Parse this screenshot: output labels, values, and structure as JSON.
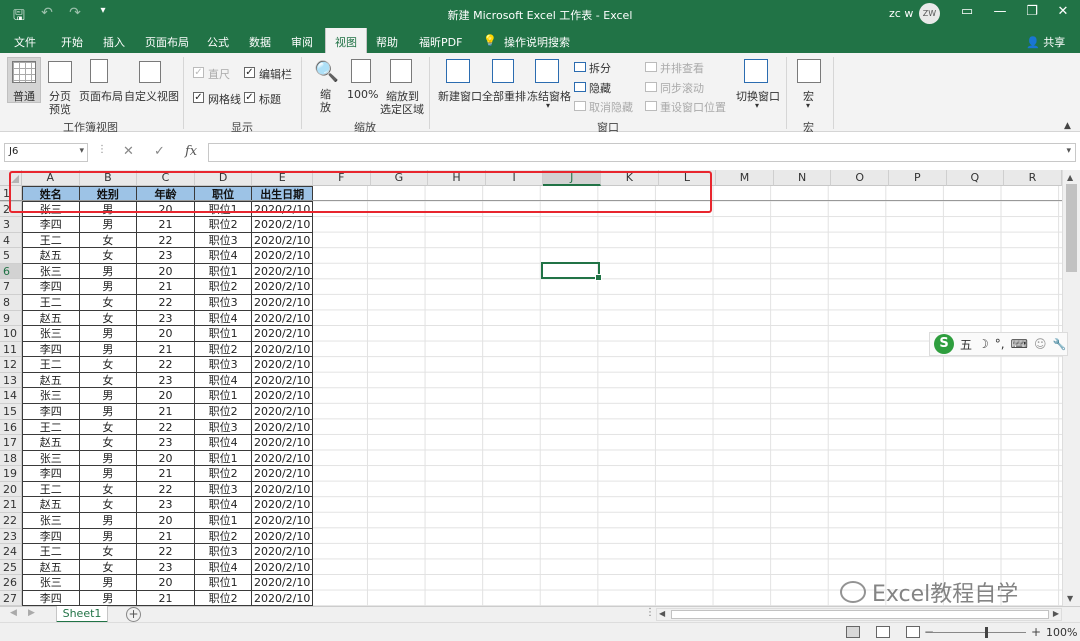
{
  "titlebar": {
    "title": "新建 Microsoft Excel 工作表 - Excel",
    "user": "zc w",
    "avatar": "ZW"
  },
  "menu": {
    "tabs": [
      "文件",
      "开始",
      "插入",
      "页面布局",
      "公式",
      "数据",
      "审阅",
      "视图",
      "帮助",
      "福昕PDF"
    ],
    "active": "视图",
    "tell_me": "操作说明搜索",
    "share": "共享"
  },
  "ribbon": {
    "workbook_views": {
      "normal": "普通",
      "page_break_1": "分页",
      "page_break_2": "预览",
      "page_layout": "页面布局",
      "custom": "自定义视图",
      "group": "工作簿视图"
    },
    "show": {
      "ruler": "直尺",
      "formula_bar": "编辑栏",
      "gridlines": "网格线",
      "headings": "标题",
      "group": "显示"
    },
    "zoom": {
      "zoom_1": "缩",
      "zoom_2": "放",
      "hundred": "100%",
      "to_selection_1": "缩放到",
      "to_selection_2": "选定区域",
      "group": "缩放"
    },
    "window": {
      "new_window": "新建窗口",
      "arrange_all": "全部重排",
      "freeze_panes": "冻结窗格",
      "split": "拆分",
      "hide": "隐藏",
      "unhide": "取消隐藏",
      "side_by_side": "并排查看",
      "sync_scroll": "同步滚动",
      "reset_position": "重设窗口位置",
      "switch_windows": "切换窗口",
      "group": "窗口"
    },
    "macros": {
      "label": "宏",
      "group": "宏"
    }
  },
  "formula_bar": {
    "name_box": "J6",
    "cancel": "✕",
    "enter": "✓",
    "fx": "fx",
    "value": ""
  },
  "columns": [
    "A",
    "B",
    "C",
    "D",
    "E",
    "F",
    "G",
    "H",
    "I",
    "J",
    "K",
    "L",
    "M",
    "N",
    "O",
    "P",
    "Q",
    "R"
  ],
  "selected_column": "J",
  "selected_row": "6",
  "sheet": {
    "headers": [
      "姓名",
      "姓别",
      "年龄",
      "职位",
      "出生日期"
    ],
    "rows": [
      [
        "张三",
        "男",
        "20",
        "职位1",
        "2020/2/10"
      ],
      [
        "李四",
        "男",
        "21",
        "职位2",
        "2020/2/10"
      ],
      [
        "王二",
        "女",
        "22",
        "职位3",
        "2020/2/10"
      ],
      [
        "赵五",
        "女",
        "23",
        "职位4",
        "2020/2/10"
      ],
      [
        "张三",
        "男",
        "20",
        "职位1",
        "2020/2/10"
      ],
      [
        "李四",
        "男",
        "21",
        "职位2",
        "2020/2/10"
      ],
      [
        "王二",
        "女",
        "22",
        "职位3",
        "2020/2/10"
      ],
      [
        "赵五",
        "女",
        "23",
        "职位4",
        "2020/2/10"
      ],
      [
        "张三",
        "男",
        "20",
        "职位1",
        "2020/2/10"
      ],
      [
        "李四",
        "男",
        "21",
        "职位2",
        "2020/2/10"
      ],
      [
        "王二",
        "女",
        "22",
        "职位3",
        "2020/2/10"
      ],
      [
        "赵五",
        "女",
        "23",
        "职位4",
        "2020/2/10"
      ],
      [
        "张三",
        "男",
        "20",
        "职位1",
        "2020/2/10"
      ],
      [
        "李四",
        "男",
        "21",
        "职位2",
        "2020/2/10"
      ],
      [
        "王二",
        "女",
        "22",
        "职位3",
        "2020/2/10"
      ],
      [
        "赵五",
        "女",
        "23",
        "职位4",
        "2020/2/10"
      ],
      [
        "张三",
        "男",
        "20",
        "职位1",
        "2020/2/10"
      ],
      [
        "李四",
        "男",
        "21",
        "职位2",
        "2020/2/10"
      ],
      [
        "王二",
        "女",
        "22",
        "职位3",
        "2020/2/10"
      ],
      [
        "赵五",
        "女",
        "23",
        "职位4",
        "2020/2/10"
      ],
      [
        "张三",
        "男",
        "20",
        "职位1",
        "2020/2/10"
      ],
      [
        "李四",
        "男",
        "21",
        "职位2",
        "2020/2/10"
      ],
      [
        "王二",
        "女",
        "22",
        "职位3",
        "2020/2/10"
      ],
      [
        "赵五",
        "女",
        "23",
        "职位4",
        "2020/2/10"
      ],
      [
        "张三",
        "男",
        "20",
        "职位1",
        "2020/2/10"
      ],
      [
        "李四",
        "男",
        "21",
        "职位2",
        "2020/2/10"
      ]
    ]
  },
  "ime": {
    "badge": "S",
    "mode": "五",
    "moon": "☽",
    "punct": "°,",
    "keyboard": "⌨",
    "user": "☺",
    "tool": "🔧"
  },
  "sheet_tabs": {
    "active": "Sheet1",
    "add": "+"
  },
  "status": {
    "zoom": "100%",
    "minus": "−",
    "plus": "+"
  },
  "watermark": "Excel教程自学",
  "colors": {
    "accent": "#217346",
    "header_fill": "#9dc3e6",
    "highlight": "#e8262e"
  }
}
